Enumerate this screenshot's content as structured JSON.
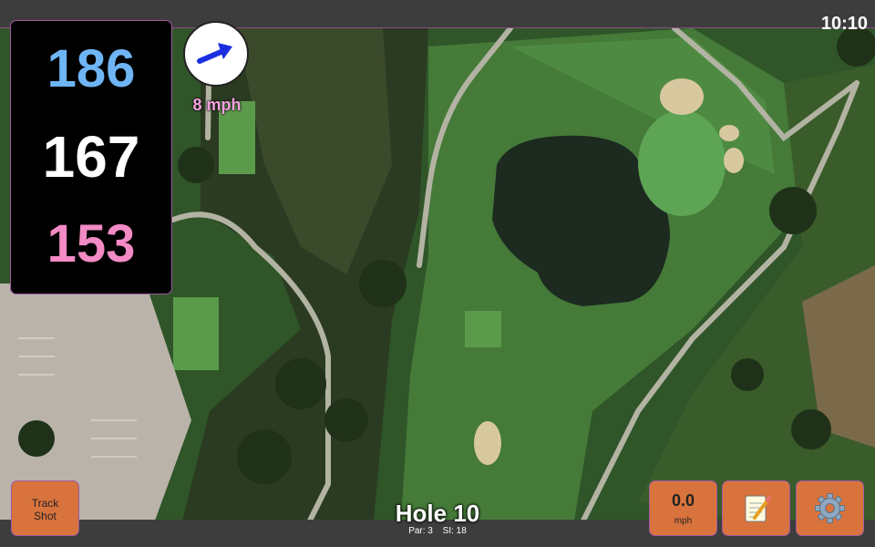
{
  "status_bar": {
    "time": "10:10"
  },
  "distances": {
    "back": "186",
    "middle": "167",
    "front": "153"
  },
  "wind": {
    "speed": "8 mph"
  },
  "buttons": {
    "track_shot": [
      "Track",
      "Shot"
    ],
    "speed_value": "0.0",
    "speed_unit": "mph",
    "notes_icon": "notepad-icon",
    "settings_icon": "gear-icon"
  },
  "hole": {
    "title": "Hole 10",
    "par": "Par: 3",
    "si": "SI: 18"
  },
  "colors": {
    "back_distance": "#6fb5f5",
    "middle_distance": "#ffffff",
    "front_distance": "#f28ac4",
    "wind_speed": "#f6a0e0",
    "button": "#d9733d",
    "bar": "#3d3d3d"
  }
}
